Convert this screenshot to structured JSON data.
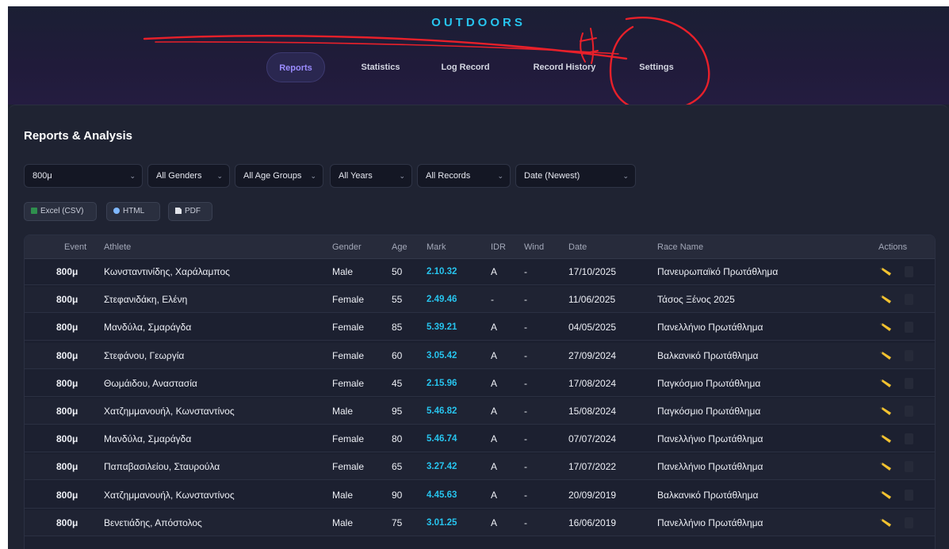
{
  "app": {
    "brand": "OUTDOORS"
  },
  "nav": {
    "tabs": [
      {
        "label": "Reports",
        "active": true
      },
      {
        "label": "Statistics",
        "active": false
      },
      {
        "label": "Log Record",
        "active": false
      },
      {
        "label": "Record History",
        "active": false
      },
      {
        "label": "Settings",
        "active": false
      }
    ]
  },
  "panel": {
    "title": "Reports & Analysis"
  },
  "filters": {
    "event": "800μ",
    "gender": "All Genders",
    "age_group": "All Age Groups",
    "year": "All Years",
    "records": "All Records",
    "sort": "Date (Newest)"
  },
  "exports": {
    "csv": "Excel (CSV)",
    "html": "HTML",
    "pdf": "PDF"
  },
  "table": {
    "columns": [
      "Event",
      "Athlete",
      "Gender",
      "Age",
      "Mark",
      "IDR",
      "Wind",
      "Date",
      "Race Name",
      "Actions"
    ],
    "rows": [
      {
        "event": "800μ",
        "athlete": "Κωνσταντινίδης, Χαράλαμπος",
        "gender": "Male",
        "age": "50",
        "mark": "2.10.32",
        "idr": "A",
        "wind": "-",
        "date": "17/10/2025",
        "race": "Πανευρωπαϊκό Πρωτάθλημα"
      },
      {
        "event": "800μ",
        "athlete": "Στεφανιδάκη, Ελένη",
        "gender": "Female",
        "age": "55",
        "mark": "2.49.46",
        "idr": "-",
        "wind": "-",
        "date": "11/06/2025",
        "race": "Τάσος Ξένος 2025"
      },
      {
        "event": "800μ",
        "athlete": "Μανδύλα, Σμαράγδα",
        "gender": "Female",
        "age": "85",
        "mark": "5.39.21",
        "idr": "A",
        "wind": "-",
        "date": "04/05/2025",
        "race": "Πανελλήνιο Πρωτάθλημα"
      },
      {
        "event": "800μ",
        "athlete": "Στεφάνου, Γεωργία",
        "gender": "Female",
        "age": "60",
        "mark": "3.05.42",
        "idr": "A",
        "wind": "-",
        "date": "27/09/2024",
        "race": "Βαλκανικό Πρωτάθλημα"
      },
      {
        "event": "800μ",
        "athlete": "Θωμάιδου, Αναστασία",
        "gender": "Female",
        "age": "45",
        "mark": "2.15.96",
        "idr": "A",
        "wind": "-",
        "date": "17/08/2024",
        "race": "Παγκόσμιο Πρωτάθλημα"
      },
      {
        "event": "800μ",
        "athlete": "Χατζημμανουήλ, Κωνσταντίνος",
        "gender": "Male",
        "age": "95",
        "mark": "5.46.82",
        "idr": "A",
        "wind": "-",
        "date": "15/08/2024",
        "race": "Παγκόσμιο Πρωτάθλημα"
      },
      {
        "event": "800μ",
        "athlete": "Μανδύλα, Σμαράγδα",
        "gender": "Female",
        "age": "80",
        "mark": "5.46.74",
        "idr": "A",
        "wind": "-",
        "date": "07/07/2024",
        "race": "Πανελλήνιο Πρωτάθλημα"
      },
      {
        "event": "800μ",
        "athlete": "Παπαβασιλείου, Σταυρούλα",
        "gender": "Female",
        "age": "65",
        "mark": "3.27.42",
        "idr": "A",
        "wind": "-",
        "date": "17/07/2022",
        "race": "Πανελλήνιο Πρωτάθλημα"
      },
      {
        "event": "800μ",
        "athlete": "Χατζημμανουήλ, Κωνσταντίνος",
        "gender": "Male",
        "age": "90",
        "mark": "4.45.63",
        "idr": "A",
        "wind": "-",
        "date": "20/09/2019",
        "race": "Βαλκανικό Πρωτάθλημα"
      },
      {
        "event": "800μ",
        "athlete": "Βενετιάδης, Απόστολος",
        "gender": "Male",
        "age": "75",
        "mark": "3.01.25",
        "idr": "A",
        "wind": "-",
        "date": "16/06/2019",
        "race": "Πανελλήνιο Πρωτάθλημα"
      }
    ]
  },
  "colors": {
    "accent": "#27c4ee",
    "active_tab": "#9b8cff",
    "annotation": "#e8202a",
    "edit_icon": "#f2c230"
  }
}
